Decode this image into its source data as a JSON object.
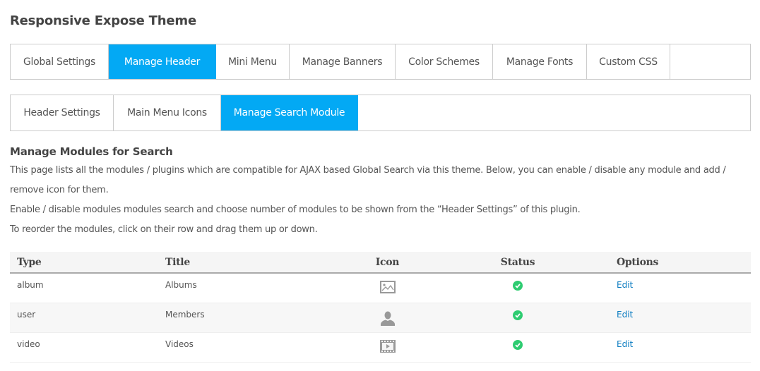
{
  "page": {
    "title": "Responsive Expose Theme"
  },
  "main_tabs": [
    {
      "label": "Global Settings",
      "active": false
    },
    {
      "label": "Manage Header",
      "active": true
    },
    {
      "label": "Mini Menu",
      "active": false
    },
    {
      "label": "Manage Banners",
      "active": false
    },
    {
      "label": "Color Schemes",
      "active": false
    },
    {
      "label": "Manage Fonts",
      "active": false
    },
    {
      "label": "Custom CSS",
      "active": false
    }
  ],
  "sub_tabs": [
    {
      "label": "Header Settings",
      "active": false
    },
    {
      "label": "Main Menu Icons",
      "active": false
    },
    {
      "label": "Manage Search Module",
      "active": true
    }
  ],
  "section": {
    "title": "Manage Modules for Search",
    "lines": [
      "This page lists all the modules / plugins which are compatible for AJAX based Global Search via this theme. Below, you can enable / disable any module and add /",
      "remove icon for them.",
      "Enable / disable modules modules search and choose number of modules to be shown from the “Header Settings” of this plugin.",
      "To reorder the modules, click on their row and drag them up or down."
    ]
  },
  "table": {
    "headers": {
      "type": "Type",
      "title": "Title",
      "icon": "Icon",
      "status": "Status",
      "options": "Options"
    },
    "rows": [
      {
        "type": "album",
        "title": "Albums",
        "icon": "image-icon",
        "status": "enabled",
        "option": "Edit"
      },
      {
        "type": "user",
        "title": "Members",
        "icon": "user-icon",
        "status": "enabled",
        "option": "Edit"
      },
      {
        "type": "video",
        "title": "Videos",
        "icon": "video-icon",
        "status": "enabled",
        "option": "Edit"
      }
    ]
  },
  "colors": {
    "accent": "#03a9f4",
    "status_enabled": "#2ecc71",
    "link": "#0b7cc1"
  }
}
